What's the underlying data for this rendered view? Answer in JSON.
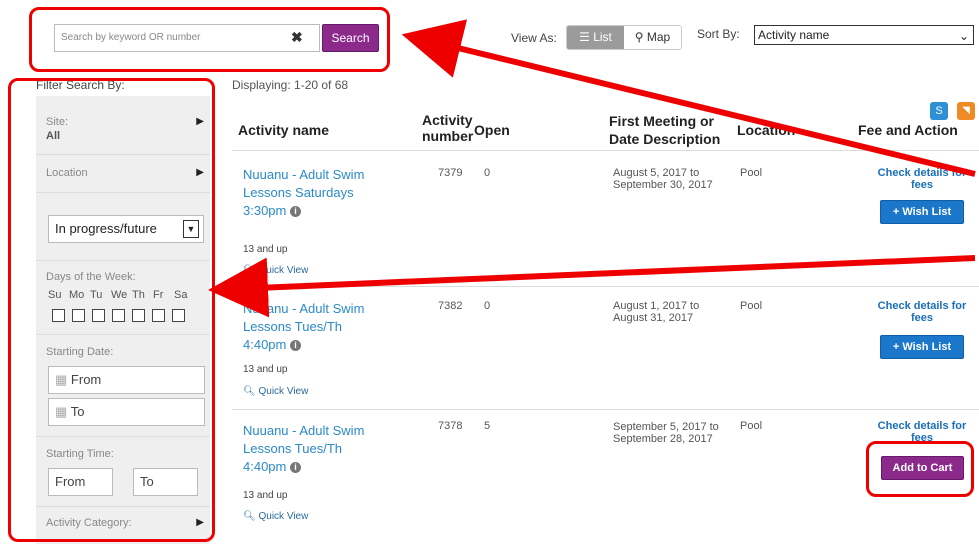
{
  "search": {
    "placeholder": "Search by keyword OR number",
    "clear_glyph": "✖",
    "button_label": "Search"
  },
  "view": {
    "label": "View As:",
    "list_label": "☰ List",
    "map_label": "⚲ Map",
    "active": "List"
  },
  "sort": {
    "label": "Sort By:",
    "selected": "Activity name",
    "caret": "⌄"
  },
  "sidebar": {
    "title": "Filter Search By:",
    "site_label": "Site:",
    "site_value": "All",
    "location_label": "Location",
    "status_selected": "In progress/future",
    "days_label": "Days of the Week:",
    "days": [
      "Su",
      "Mo",
      "Tu",
      "We",
      "Th",
      "Fr",
      "Sa"
    ],
    "starting_date_label": "Starting Date:",
    "from_placeholder": "From",
    "to_placeholder": "To",
    "starting_time_label": "Starting Time:",
    "time_from": "From",
    "time_to": "To",
    "activity_category_label": "Activity Category:"
  },
  "results": {
    "displaying": "Displaying: 1-20 of 68",
    "headers": {
      "name": "Activity name",
      "number_line1": "Activity",
      "number_line2": "number",
      "open": "Open",
      "date_line1": "First Meeting or",
      "date_line2": "Date Description",
      "location": "Location",
      "fee": "Fee and Action"
    },
    "rows": [
      {
        "name": "Nuuanu - Adult Swim Lessons Saturdays 3:30pm",
        "number": "7379",
        "open": "0",
        "date": "August 5, 2017 to September 30, 2017",
        "location": "Pool",
        "fee": "Check details for fees",
        "age": "13 and up",
        "quick": "Quick View",
        "action": "+ Wish List"
      },
      {
        "name": "Nuuanu - Adult Swim Lessons Tues/Th 4:40pm",
        "number": "7382",
        "open": "0",
        "date": "August 1, 2017 to August 31, 2017",
        "location": "Pool",
        "fee": "Check details for fees",
        "age": "13 and up",
        "quick": "Quick View",
        "action": "+ Wish List"
      },
      {
        "name": "Nuuanu - Adult Swim Lessons Tues/Th 4:40pm",
        "number": "7378",
        "open": "5",
        "date": "September 5, 2017 to September 28, 2017",
        "location": "Pool",
        "fee": "Check details for fees",
        "age": "13 and up",
        "quick": "Quick View",
        "action": "Add to Cart"
      }
    ]
  },
  "colors": {
    "primary_purple": "#8b2a8b",
    "link_blue": "#2a8ac8",
    "wish_blue": "#1a77c9",
    "annotation_red": "#ee0000"
  }
}
